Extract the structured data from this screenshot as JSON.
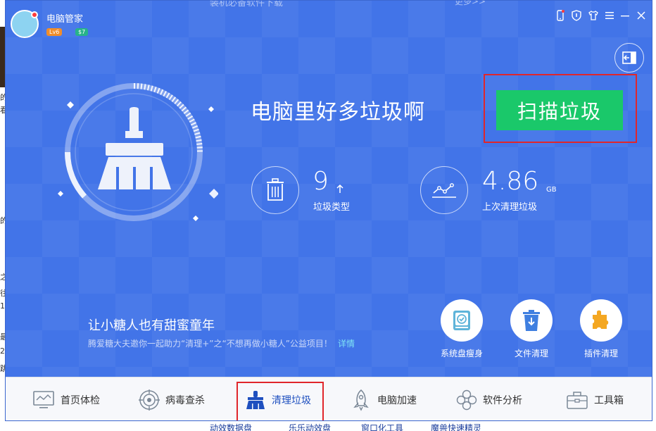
{
  "background_page": {
    "header_text": "装机必备软件下载",
    "more_link": "更多>>",
    "bottom_links": [
      "动效数据盘",
      "乐乐动效盘",
      "窗口化工具",
      "魔兽快速精灵"
    ],
    "left_edge_chars": [
      "的",
      "看",
      "的",
      "之",
      "往",
      "1",
      "最",
      "2",
      "跳"
    ]
  },
  "app": {
    "title": "电脑管家",
    "level_badge": "Lv6",
    "vip_badge": "$7",
    "window_buttons": [
      "phone-icon",
      "shield-icon",
      "shirt-icon",
      "menu-icon",
      "minimize-icon",
      "close-icon"
    ]
  },
  "main": {
    "headline": "电脑里好多垃圾啊",
    "scan_button": "扫描垃圾",
    "stats": {
      "types_value": "9",
      "types_label": "垃圾类型",
      "last_value": "4.86",
      "last_unit": "GB",
      "last_label": "上次清理垃圾"
    }
  },
  "promo": {
    "title": "让小糖人也有甜蜜童年",
    "subtitle": "腾爱糖大夫邀你一起助力“清理+”之“不想再做小糖人”公益项目！",
    "link": "详情"
  },
  "tools": [
    {
      "label": "系统盘瘦身",
      "icon": "disk-check-icon"
    },
    {
      "label": "文件清理",
      "icon": "file-trash-icon"
    },
    {
      "label": "插件清理",
      "icon": "puzzle-icon"
    }
  ],
  "nav": [
    {
      "label": "首页体检",
      "icon": "monitor-icon"
    },
    {
      "label": "病毒查杀",
      "icon": "target-icon"
    },
    {
      "label": "清理垃圾",
      "icon": "broom-icon"
    },
    {
      "label": "电脑加速",
      "icon": "rocket-icon"
    },
    {
      "label": "软件分析",
      "icon": "flower-icon"
    },
    {
      "label": "工具箱",
      "icon": "toolbox-icon"
    }
  ],
  "colors": {
    "window_blue": "#4274e8",
    "scan_green": "#1ac86a",
    "highlight_red": "#e0262b"
  }
}
